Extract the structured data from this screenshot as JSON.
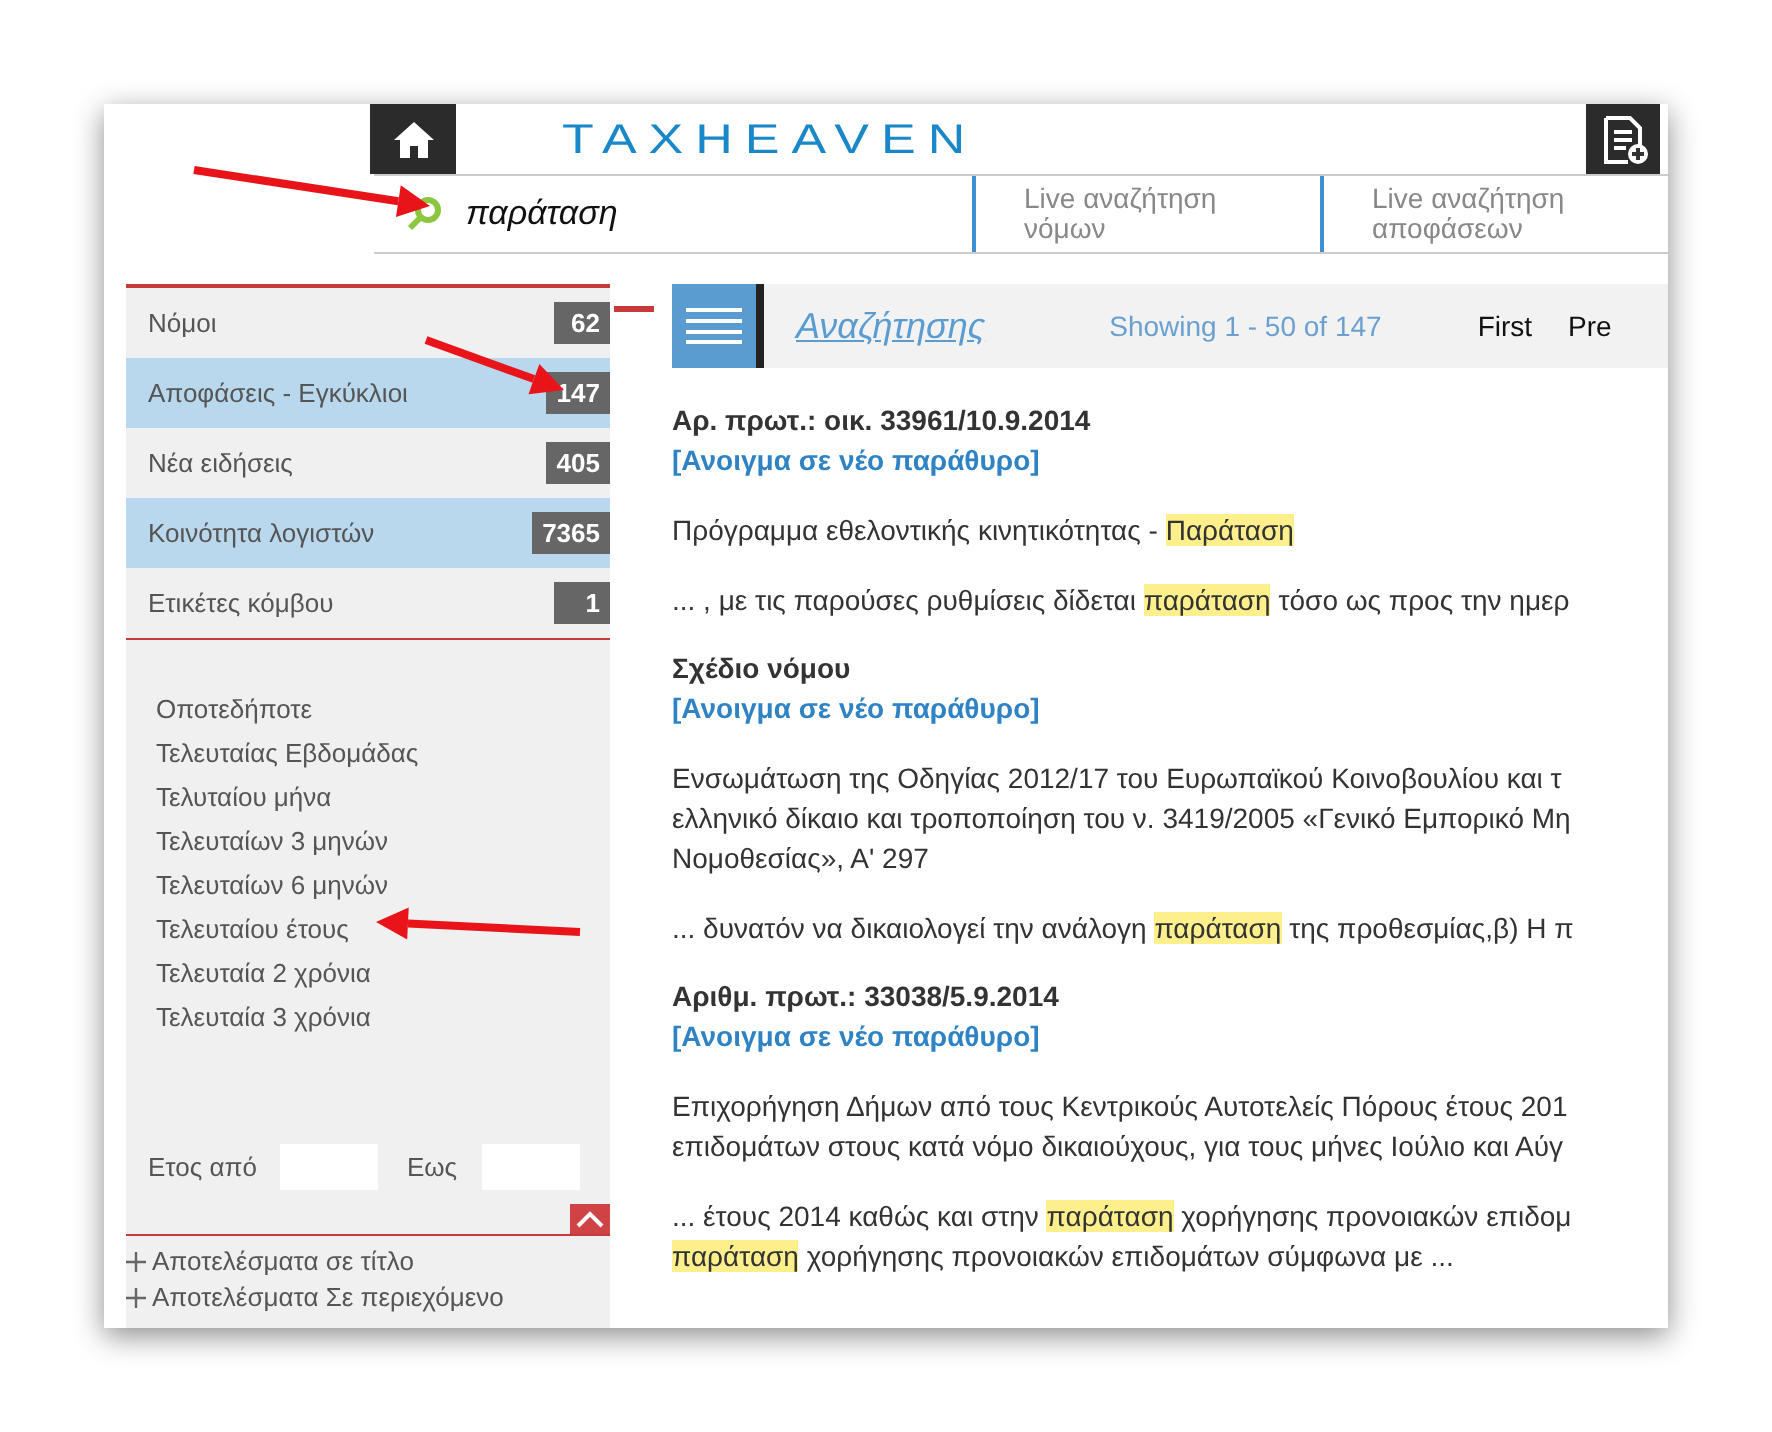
{
  "header": {
    "logo": "TAXHEAVEN"
  },
  "search": {
    "value": "παράταση"
  },
  "live_links": [
    "Live αναζήτηση\nνόμων",
    "Live αναζήτηση\nαποφάσεων"
  ],
  "sidebar": {
    "categories": [
      {
        "label": "Νόμοι",
        "count": "62",
        "selected": false
      },
      {
        "label": "Αποφάσεις - Εγκύκλιοι",
        "count": "147",
        "selected": true
      },
      {
        "label": "Νέα ειδήσεις",
        "count": "405",
        "selected": false
      },
      {
        "label": "Κοινότητα λογιστών",
        "count": "7365",
        "selected": true
      },
      {
        "label": "Ετικέτες κόμβου",
        "count": "1",
        "selected": false
      }
    ],
    "date_filters": [
      "Οποτεδήποτε",
      "Τελευταίας Εβδομάδας",
      "Τελυταίου μήνα",
      "Τελευταίων 3 μηνών",
      "Τελευταίων 6 μηνών",
      "Τελευταίου έτους",
      "Τελευταία 2 χρόνια",
      "Τελευταία 3 χρόνια"
    ],
    "year_from": {
      "label": "Ετος από"
    },
    "year_to": {
      "label": "Εως"
    },
    "options": [
      "Αποτελέσματα σε τίτλο",
      "Αποτελέσματα Σε περιεχόμενο"
    ]
  },
  "toolbar": {
    "title": "Αναζήτησης",
    "showing": "Showing 1 - 50 of 147",
    "pager": [
      "First",
      "Pre"
    ]
  },
  "results": [
    {
      "title": "Αρ. πρωτ.: οικ. 33961/10.9.2014",
      "link": "[Ανοιγμα σε νέο παράθυρο]",
      "summary": [
        {
          "text": "Πρόγραμμα εθελοντικής κινητικότητας - ",
          "highlight": false
        },
        {
          "text": "Παράταση",
          "highlight": true
        }
      ],
      "snippet": [
        {
          "text": "... , με τις παρούσες ρυθμίσεις δίδεται ",
          "highlight": false
        },
        {
          "text": "παράταση",
          "highlight": true
        },
        {
          "text": " τόσο ως προς την ημερ",
          "highlight": false
        }
      ]
    },
    {
      "title": "Σχέδιο νόμου",
      "link": "[Ανοιγμα σε νέο παράθυρο]",
      "summary": [
        {
          "text": "Ενσωμάτωση της Οδηγίας 2012/17 του Ευρωπαϊκού Κοινοβουλίου και τ\nελληνικό δίκαιο και τροποποίηση του ν. 3419/2005 «Γενικό Εμπορικό Μη\nΝομοθεσίας», Α' 297",
          "highlight": false
        }
      ],
      "snippet": [
        {
          "text": "... δυνατόν να δικαιολογεί την ανάλογη ",
          "highlight": false
        },
        {
          "text": "παράταση",
          "highlight": true
        },
        {
          "text": " της προθεσμίας,β) Η π",
          "highlight": false
        }
      ]
    },
    {
      "title": "Αριθμ. πρωτ.: 33038/5.9.2014",
      "link": "[Ανοιγμα σε νέο παράθυρο]",
      "summary": [
        {
          "text": "Επιχορήγηση Δήμων από τους Κεντρικούς Αυτοτελείς Πόρους έτους 201\nεπιδομάτων στους κατά νόμο δικαιούχους, για τους μήνες Ιούλιο και Αύγ",
          "highlight": false
        }
      ],
      "snippet": [
        {
          "text": "... έτους 2014 καθώς και στην ",
          "highlight": false
        },
        {
          "text": "παράταση",
          "highlight": true
        },
        {
          "text": " χορήγησης προνοιακών επιδομ\n",
          "highlight": false
        },
        {
          "text": "παράταση",
          "highlight": true
        },
        {
          "text": " χορήγησης προνοιακών επιδομάτων σύμφωνα με ...",
          "highlight": false
        }
      ]
    }
  ]
}
